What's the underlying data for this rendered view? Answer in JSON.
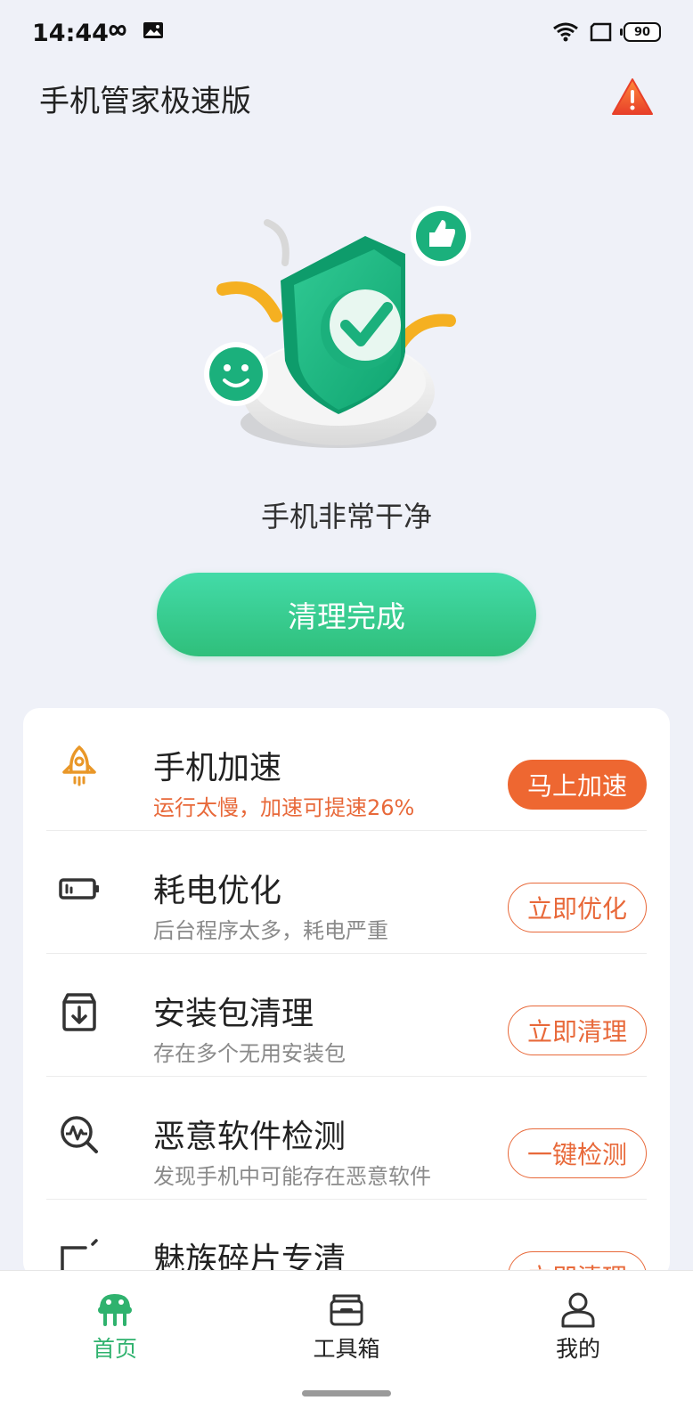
{
  "status_bar": {
    "time": "14:44",
    "battery": "90"
  },
  "header": {
    "title": "手机管家极速版"
  },
  "hero": {
    "status_text": "手机非常干净",
    "button_label": "清理完成"
  },
  "colors": {
    "accent_green": "#2fbf7b",
    "accent_orange": "#ee6731",
    "background": "#eff1f8"
  },
  "features": [
    {
      "title": "手机加速",
      "subtitle": "运行太慢，加速可提速26%",
      "button": "马上加速",
      "icon": "rocket-icon"
    },
    {
      "title": "耗电优化",
      "subtitle": "后台程序太多，耗电严重",
      "button": "立即优化",
      "icon": "battery-icon"
    },
    {
      "title": "安装包清理",
      "subtitle": "存在多个无用安装包",
      "button": "立即清理",
      "icon": "package-download-icon"
    },
    {
      "title": "恶意软件检测",
      "subtitle": "发现手机中可能存在恶意软件",
      "button": "一键检测",
      "icon": "malware-scan-icon"
    },
    {
      "title": "魅族碎片专清",
      "subtitle": "",
      "button": "立即清理",
      "icon": "fragment-clean-icon"
    }
  ],
  "bottom_nav": [
    {
      "label": "首页",
      "icon": "alien-home-icon",
      "active": true
    },
    {
      "label": "工具箱",
      "icon": "toolbox-icon",
      "active": false
    },
    {
      "label": "我的",
      "icon": "profile-icon",
      "active": false
    }
  ]
}
